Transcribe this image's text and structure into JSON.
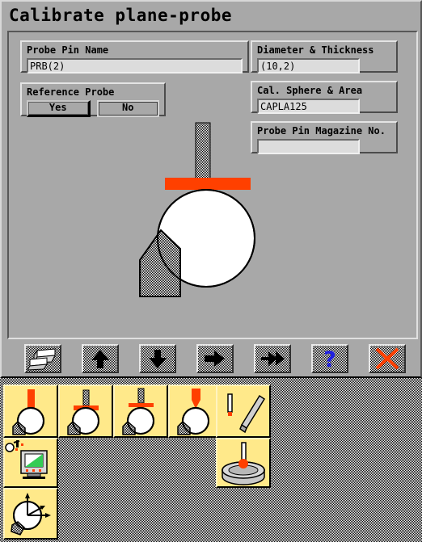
{
  "window": {
    "title": "Calibrate plane-probe"
  },
  "form": {
    "probe_pin_name": {
      "label": "Probe Pin Name",
      "value": "PRB(2)"
    },
    "reference_probe": {
      "label": "Reference Probe",
      "yes_label": "Yes",
      "no_label": "No",
      "selected": "Yes"
    },
    "diameter_thickness": {
      "label": "Diameter & Thickness",
      "value": "(10,2)"
    },
    "cal_sphere_area": {
      "label": "Cal. Sphere & Area",
      "value": "CAPLA125"
    },
    "probe_pin_magazine": {
      "label": "Probe Pin Magazine No.",
      "value": ""
    }
  },
  "colors": {
    "face": "#a8a8a8",
    "probe_orange": "#ff4000",
    "palette_yellow": "#ffe98a",
    "help_blue": "#2020e0",
    "cancel_red": "#ff4000",
    "screen_green": "#33cc55"
  },
  "diagram": {
    "name": "plane-probe-calibration-diagram",
    "parts": [
      "probe-shaft",
      "plane-probe-disc",
      "calibration-sphere",
      "probe-stem"
    ]
  },
  "toolbar": {
    "buttons": [
      {
        "name": "plane-shapes-icon",
        "tooltip": "Plane elements"
      },
      {
        "name": "arrow-up-icon",
        "tooltip": "Previous"
      },
      {
        "name": "arrow-down-icon",
        "tooltip": "Next"
      },
      {
        "name": "arrow-right-icon",
        "tooltip": "Execute"
      },
      {
        "name": "arrow-double-right-icon",
        "tooltip": "Execute all"
      },
      {
        "name": "question-mark-icon",
        "tooltip": "Help"
      },
      {
        "name": "cross-icon",
        "tooltip": "Cancel"
      }
    ]
  },
  "palette": {
    "row1": [
      {
        "name": "probe-bar-on-sphere-icon"
      },
      {
        "name": "probe-disc-on-sphere-icon"
      },
      {
        "name": "probe-disc-above-sphere-icon"
      },
      {
        "name": "probe-cone-on-sphere-icon"
      },
      {
        "name": "probe-angled-bar-icon"
      }
    ],
    "row2": [
      {
        "name": "monitor-graph-icon"
      },
      {
        "name": "disc-puck-probe-icon"
      }
    ],
    "row3": [
      {
        "name": "sphere-axes-icon"
      }
    ]
  }
}
